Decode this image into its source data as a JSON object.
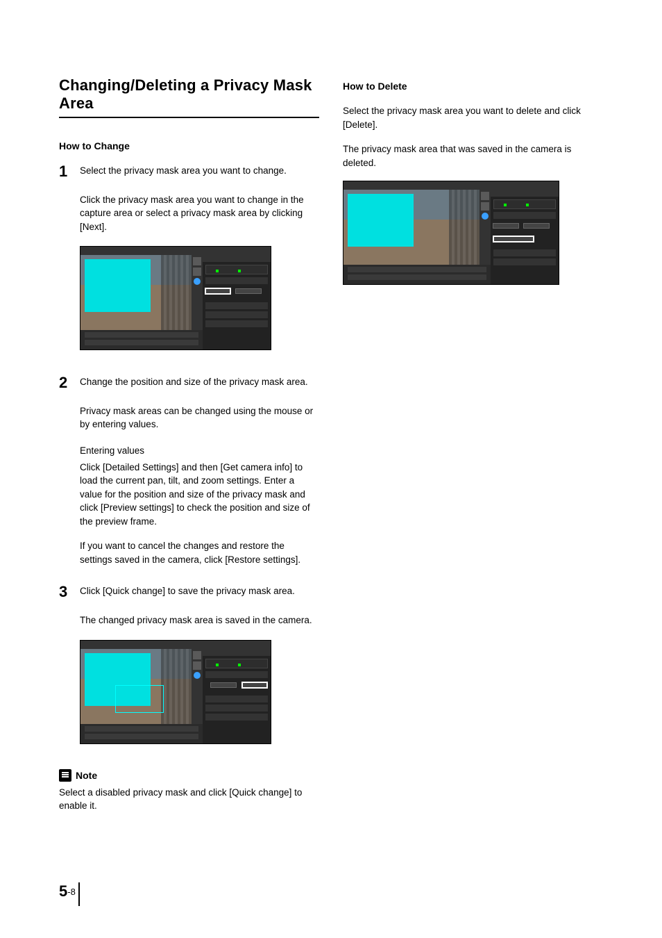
{
  "left": {
    "section_title": "Changing/Deleting a Privacy Mask Area",
    "how_to_change": "How to Change",
    "steps": [
      {
        "num": "1",
        "lead": "Select the privacy mask area you want to change.",
        "para": "Click the privacy mask area you want to change in the capture area or select a privacy mask area by clicking [Next]."
      },
      {
        "num": "2",
        "lead": "Change the position and size of the privacy mask area.",
        "para1": "Privacy mask areas can be changed using the mouse or by entering values.",
        "sub_title": "Entering values",
        "sub_para1": "Click [Detailed Settings] and then [Get camera info] to load the current pan, tilt, and zoom settings. Enter a value for the position and size of the privacy mask and click [Preview settings] to check the position and size of the preview frame.",
        "sub_para2": "If you want to cancel the changes and restore the settings saved in the camera, click [Restore settings]."
      },
      {
        "num": "3",
        "lead": "Click [Quick change] to save the privacy mask area.",
        "para": "The changed privacy mask area is saved in the camera."
      }
    ],
    "note_label": "Note",
    "note_text": "Select a disabled privacy mask and click [Quick change] to enable it."
  },
  "right": {
    "how_to_delete": "How to Delete",
    "para1": "Select the privacy mask area you want to delete and click [Delete].",
    "para2": "The privacy mask area that was saved in the camera is deleted."
  },
  "footer": {
    "chapter": "5",
    "page": "-8"
  }
}
